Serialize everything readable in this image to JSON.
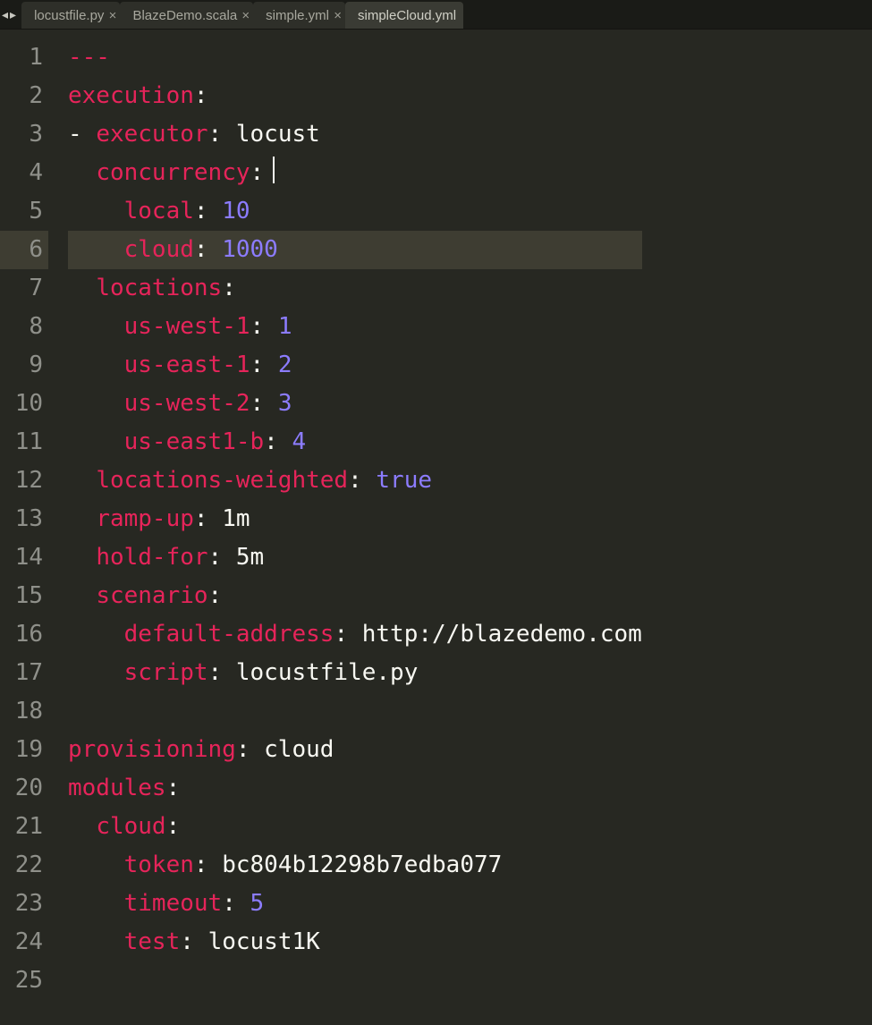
{
  "tabs": [
    {
      "label": "locustfile.py",
      "closeable": true,
      "active": false
    },
    {
      "label": "BlazeDemo.scala",
      "closeable": true,
      "active": false
    },
    {
      "label": "simple.yml",
      "closeable": true,
      "active": false
    },
    {
      "label": "simpleCloud.yml",
      "closeable": false,
      "active": true
    }
  ],
  "nav": {
    "back": "◂",
    "fwd": "▸"
  },
  "lines": [
    {
      "num": 1,
      "tokens": [
        {
          "t": "---",
          "cls": "k"
        }
      ]
    },
    {
      "num": 2,
      "tokens": [
        {
          "t": "execution",
          "cls": "k"
        },
        {
          "t": ":",
          "cls": "c"
        }
      ]
    },
    {
      "num": 3,
      "tokens": [
        {
          "t": "- ",
          "cls": "c"
        },
        {
          "t": "executor",
          "cls": "k"
        },
        {
          "t": ": ",
          "cls": "c"
        },
        {
          "t": "locust",
          "cls": "s"
        }
      ]
    },
    {
      "num": 4,
      "tokens": [
        {
          "t": "  ",
          "cls": "c"
        },
        {
          "t": "concurrency",
          "cls": "k"
        },
        {
          "t": ":",
          "cls": "c"
        }
      ],
      "cursor": true
    },
    {
      "num": 5,
      "tokens": [
        {
          "t": "    ",
          "cls": "c"
        },
        {
          "t": "local",
          "cls": "k"
        },
        {
          "t": ": ",
          "cls": "c"
        },
        {
          "t": "10",
          "cls": "n"
        }
      ]
    },
    {
      "num": 6,
      "hl": true,
      "tokens": [
        {
          "t": "    ",
          "cls": "c"
        },
        {
          "t": "cloud",
          "cls": "k"
        },
        {
          "t": ": ",
          "cls": "c"
        },
        {
          "t": "1000",
          "cls": "n"
        }
      ]
    },
    {
      "num": 7,
      "tokens": [
        {
          "t": "  ",
          "cls": "c"
        },
        {
          "t": "locations",
          "cls": "k"
        },
        {
          "t": ":",
          "cls": "c"
        }
      ]
    },
    {
      "num": 8,
      "tokens": [
        {
          "t": "    ",
          "cls": "c"
        },
        {
          "t": "us-west-1",
          "cls": "k"
        },
        {
          "t": ": ",
          "cls": "c"
        },
        {
          "t": "1",
          "cls": "n"
        }
      ]
    },
    {
      "num": 9,
      "tokens": [
        {
          "t": "    ",
          "cls": "c"
        },
        {
          "t": "us-east-1",
          "cls": "k"
        },
        {
          "t": ": ",
          "cls": "c"
        },
        {
          "t": "2",
          "cls": "n"
        }
      ]
    },
    {
      "num": 10,
      "tokens": [
        {
          "t": "    ",
          "cls": "c"
        },
        {
          "t": "us-west-2",
          "cls": "k"
        },
        {
          "t": ": ",
          "cls": "c"
        },
        {
          "t": "3",
          "cls": "n"
        }
      ]
    },
    {
      "num": 11,
      "tokens": [
        {
          "t": "    ",
          "cls": "c"
        },
        {
          "t": "us-east1-b",
          "cls": "k"
        },
        {
          "t": ": ",
          "cls": "c"
        },
        {
          "t": "4",
          "cls": "n"
        }
      ]
    },
    {
      "num": 12,
      "tokens": [
        {
          "t": "  ",
          "cls": "c"
        },
        {
          "t": "locations-weighted",
          "cls": "k"
        },
        {
          "t": ": ",
          "cls": "c"
        },
        {
          "t": "true",
          "cls": "b"
        }
      ]
    },
    {
      "num": 13,
      "tokens": [
        {
          "t": "  ",
          "cls": "c"
        },
        {
          "t": "ramp-up",
          "cls": "k"
        },
        {
          "t": ": ",
          "cls": "c"
        },
        {
          "t": "1m",
          "cls": "s"
        }
      ]
    },
    {
      "num": 14,
      "tokens": [
        {
          "t": "  ",
          "cls": "c"
        },
        {
          "t": "hold-for",
          "cls": "k"
        },
        {
          "t": ": ",
          "cls": "c"
        },
        {
          "t": "5m",
          "cls": "s"
        }
      ]
    },
    {
      "num": 15,
      "tokens": [
        {
          "t": "  ",
          "cls": "c"
        },
        {
          "t": "scenario",
          "cls": "k"
        },
        {
          "t": ":",
          "cls": "c"
        }
      ]
    },
    {
      "num": 16,
      "tokens": [
        {
          "t": "    ",
          "cls": "c"
        },
        {
          "t": "default-address",
          "cls": "k"
        },
        {
          "t": ": ",
          "cls": "c"
        },
        {
          "t": "http://blazedemo.com",
          "cls": "s"
        }
      ]
    },
    {
      "num": 17,
      "tokens": [
        {
          "t": "    ",
          "cls": "c"
        },
        {
          "t": "script",
          "cls": "k"
        },
        {
          "t": ": ",
          "cls": "c"
        },
        {
          "t": "locustfile.py",
          "cls": "s"
        }
      ]
    },
    {
      "num": 18,
      "tokens": [
        {
          "t": "",
          "cls": "c"
        }
      ]
    },
    {
      "num": 19,
      "tokens": [
        {
          "t": "provisioning",
          "cls": "k"
        },
        {
          "t": ": ",
          "cls": "c"
        },
        {
          "t": "cloud",
          "cls": "s"
        }
      ]
    },
    {
      "num": 20,
      "tokens": [
        {
          "t": "modules",
          "cls": "k"
        },
        {
          "t": ":",
          "cls": "c"
        }
      ]
    },
    {
      "num": 21,
      "tokens": [
        {
          "t": "  ",
          "cls": "c"
        },
        {
          "t": "cloud",
          "cls": "k"
        },
        {
          "t": ":",
          "cls": "c"
        }
      ]
    },
    {
      "num": 22,
      "tokens": [
        {
          "t": "    ",
          "cls": "c"
        },
        {
          "t": "token",
          "cls": "k"
        },
        {
          "t": ": ",
          "cls": "c"
        },
        {
          "t": "bc804b12298b7edba077",
          "cls": "s"
        }
      ]
    },
    {
      "num": 23,
      "tokens": [
        {
          "t": "    ",
          "cls": "c"
        },
        {
          "t": "timeout",
          "cls": "k"
        },
        {
          "t": ": ",
          "cls": "c"
        },
        {
          "t": "5",
          "cls": "n"
        }
      ]
    },
    {
      "num": 24,
      "tokens": [
        {
          "t": "    ",
          "cls": "c"
        },
        {
          "t": "test",
          "cls": "k"
        },
        {
          "t": ": ",
          "cls": "c"
        },
        {
          "t": "locust1K",
          "cls": "s"
        }
      ]
    },
    {
      "num": 25,
      "tokens": [
        {
          "t": "",
          "cls": "c"
        }
      ]
    }
  ]
}
